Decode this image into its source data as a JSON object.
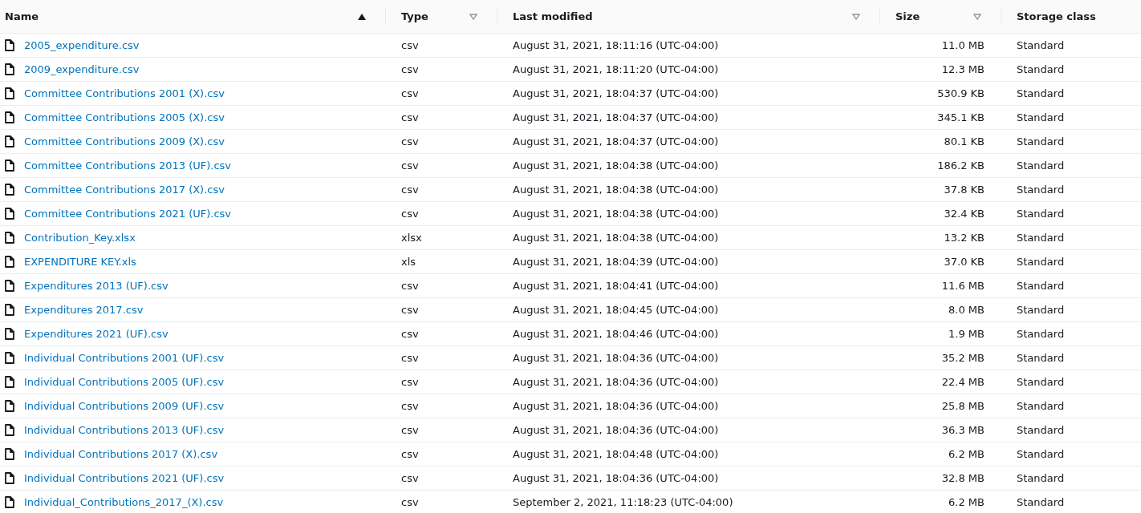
{
  "table": {
    "columns": [
      {
        "label": "Name",
        "sorted": true
      },
      {
        "label": "Type",
        "sorted": false
      },
      {
        "label": "Last modified",
        "sorted": false
      },
      {
        "label": "Size",
        "sorted": false
      },
      {
        "label": "Storage class"
      }
    ],
    "rows": [
      {
        "name": "2005_expenditure.csv",
        "type": "csv",
        "modified": "August 31, 2021, 18:11:16 (UTC-04:00)",
        "size": "11.0 MB",
        "storage": "Standard"
      },
      {
        "name": "2009_expenditure.csv",
        "type": "csv",
        "modified": "August 31, 2021, 18:11:20 (UTC-04:00)",
        "size": "12.3 MB",
        "storage": "Standard"
      },
      {
        "name": "Committee Contributions 2001 (X).csv",
        "type": "csv",
        "modified": "August 31, 2021, 18:04:37 (UTC-04:00)",
        "size": "530.9 KB",
        "storage": "Standard"
      },
      {
        "name": "Committee Contributions 2005 (X).csv",
        "type": "csv",
        "modified": "August 31, 2021, 18:04:37 (UTC-04:00)",
        "size": "345.1 KB",
        "storage": "Standard"
      },
      {
        "name": "Committee Contributions 2009 (X).csv",
        "type": "csv",
        "modified": "August 31, 2021, 18:04:37 (UTC-04:00)",
        "size": "80.1 KB",
        "storage": "Standard"
      },
      {
        "name": "Committee Contributions 2013 (UF).csv",
        "type": "csv",
        "modified": "August 31, 2021, 18:04:38 (UTC-04:00)",
        "size": "186.2 KB",
        "storage": "Standard"
      },
      {
        "name": "Committee Contributions 2017 (X).csv",
        "type": "csv",
        "modified": "August 31, 2021, 18:04:38 (UTC-04:00)",
        "size": "37.8 KB",
        "storage": "Standard"
      },
      {
        "name": "Committee Contributions 2021 (UF).csv",
        "type": "csv",
        "modified": "August 31, 2021, 18:04:38 (UTC-04:00)",
        "size": "32.4 KB",
        "storage": "Standard"
      },
      {
        "name": "Contribution_Key.xlsx",
        "type": "xlsx",
        "modified": "August 31, 2021, 18:04:38 (UTC-04:00)",
        "size": "13.2 KB",
        "storage": "Standard"
      },
      {
        "name": "EXPENDITURE KEY.xls",
        "type": "xls",
        "modified": "August 31, 2021, 18:04:39 (UTC-04:00)",
        "size": "37.0 KB",
        "storage": "Standard"
      },
      {
        "name": "Expenditures 2013 (UF).csv",
        "type": "csv",
        "modified": "August 31, 2021, 18:04:41 (UTC-04:00)",
        "size": "11.6 MB",
        "storage": "Standard"
      },
      {
        "name": "Expenditures 2017.csv",
        "type": "csv",
        "modified": "August 31, 2021, 18:04:45 (UTC-04:00)",
        "size": "8.0 MB",
        "storage": "Standard"
      },
      {
        "name": "Expenditures 2021 (UF).csv",
        "type": "csv",
        "modified": "August 31, 2021, 18:04:46 (UTC-04:00)",
        "size": "1.9 MB",
        "storage": "Standard"
      },
      {
        "name": "Individual Contributions 2001 (UF).csv",
        "type": "csv",
        "modified": "August 31, 2021, 18:04:36 (UTC-04:00)",
        "size": "35.2 MB",
        "storage": "Standard"
      },
      {
        "name": "Individual Contributions 2005 (UF).csv",
        "type": "csv",
        "modified": "August 31, 2021, 18:04:36 (UTC-04:00)",
        "size": "22.4 MB",
        "storage": "Standard"
      },
      {
        "name": "Individual Contributions 2009 (UF).csv",
        "type": "csv",
        "modified": "August 31, 2021, 18:04:36 (UTC-04:00)",
        "size": "25.8 MB",
        "storage": "Standard"
      },
      {
        "name": "Individual Contributions 2013 (UF).csv",
        "type": "csv",
        "modified": "August 31, 2021, 18:04:36 (UTC-04:00)",
        "size": "36.3 MB",
        "storage": "Standard"
      },
      {
        "name": "Individual Contributions 2017 (X).csv",
        "type": "csv",
        "modified": "August 31, 2021, 18:04:48 (UTC-04:00)",
        "size": "6.2 MB",
        "storage": "Standard"
      },
      {
        "name": "Individual Contributions 2021 (UF).csv",
        "type": "csv",
        "modified": "August 31, 2021, 18:04:36 (UTC-04:00)",
        "size": "32.8 MB",
        "storage": "Standard"
      },
      {
        "name": "Individual_Contributions_2017_(X).csv",
        "type": "csv",
        "modified": "September 2, 2021, 11:18:23 (UTC-04:00)",
        "size": "6.2 MB",
        "storage": "Standard"
      }
    ]
  }
}
